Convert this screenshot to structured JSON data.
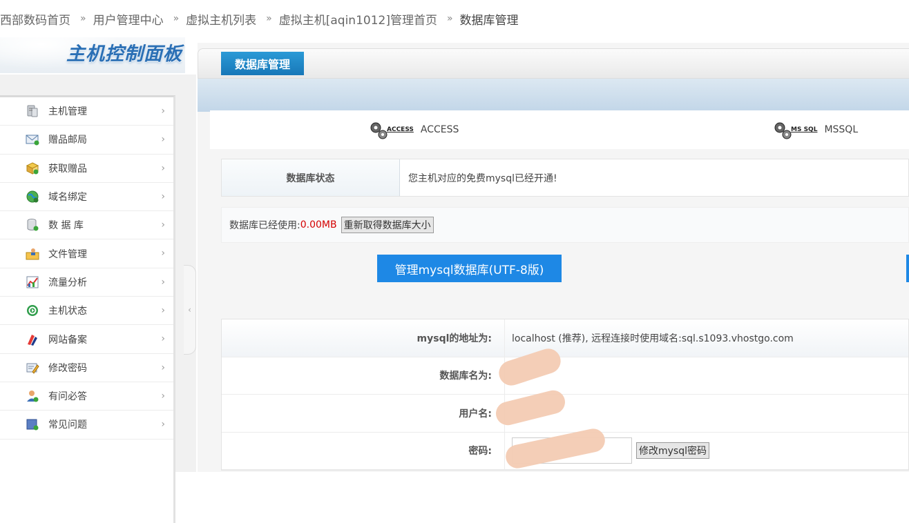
{
  "breadcrumb": {
    "items": [
      "西部数码首页",
      "用户管理中心",
      "虚拟主机列表",
      "虚拟主机[aqin1012]管理首页",
      "数据库管理"
    ],
    "separator": "»"
  },
  "brand": {
    "title": "主机控制面板"
  },
  "sidebar": {
    "items": [
      {
        "label": "主机管理",
        "icon": "server-icon"
      },
      {
        "label": "赠品邮局",
        "icon": "mail-icon"
      },
      {
        "label": "获取赠品",
        "icon": "gift-box-icon"
      },
      {
        "label": "域名绑定",
        "icon": "globe-icon"
      },
      {
        "label": "数 据 库",
        "icon": "database-icon"
      },
      {
        "label": "文件管理",
        "icon": "folder-user-icon"
      },
      {
        "label": "流量分析",
        "icon": "chart-icon"
      },
      {
        "label": "主机状态",
        "icon": "power-status-icon"
      },
      {
        "label": "网站备案",
        "icon": "record-icon"
      },
      {
        "label": "修改密码",
        "icon": "edit-password-icon"
      },
      {
        "label": "有问必答",
        "icon": "support-user-icon"
      },
      {
        "label": "常见问题",
        "icon": "faq-icon"
      }
    ],
    "arrow": "›",
    "collapse": "‹"
  },
  "panel": {
    "tab": "数据库管理"
  },
  "db_types": [
    {
      "label": "ACCESS",
      "badge": "ACCESS",
      "icon": "gears-icon"
    },
    {
      "label": "MSSQL",
      "badge": "MS SQL",
      "icon": "gears-icon"
    }
  ],
  "status": {
    "label": "数据库状态",
    "value": "您主机对应的免费mysql已经开通!"
  },
  "usage": {
    "prefix": "数据库已经使用:",
    "value": "0.00MB",
    "refresh_label": "重新取得数据库大小"
  },
  "manage_button": "管理mysql数据库(UTF-8版)",
  "info": {
    "address_label": "mysql的地址为:",
    "address_value": "localhost (推荐), 远程连接时使用域名:sql.s1093.vhostgo.com",
    "dbname_label": "数据库名为:",
    "username_label": "用户名:",
    "password_label": "密码:",
    "change_pw_label": "修改mysql密码"
  },
  "colors": {
    "accent": "#1e88e5",
    "tab": "#1f82c3",
    "usage_value": "#d40000",
    "redaction": "#f3cbb3"
  }
}
